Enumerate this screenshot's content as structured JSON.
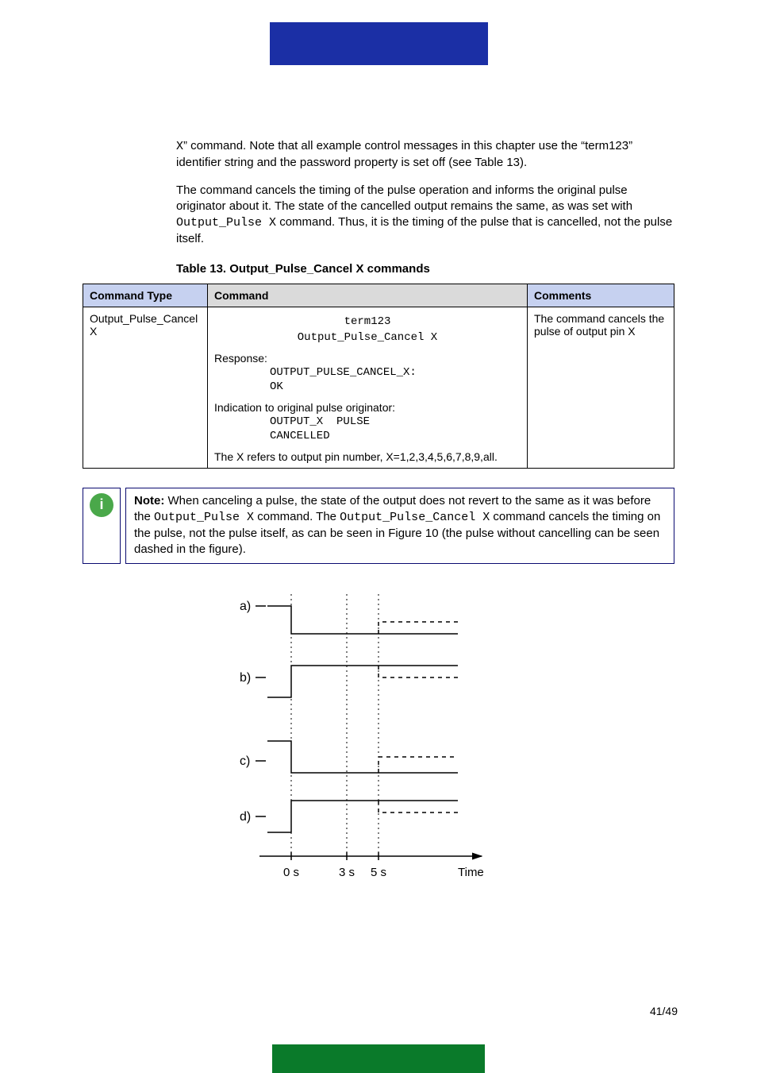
{
  "intro": {
    "para1_prefix_code": "X",
    "para1_text": "” command. Note that all example control messages in this chapter use the “term123” identifier string and the password property is set off (see Table 13).",
    "para2_before_code": "The command cancels the timing of the pulse operation and informs the original pulse originator about it. The state of the cancelled output remains the same, as was set with ",
    "code_in_para2": "Output_Pulse X",
    "para2_after_code": " command. Thus, it is the timing of the pulse that is cancelled, not the pulse itself."
  },
  "table": {
    "caption": "Table 13. Output_Pulse_Cancel X commands",
    "headers": {
      "command_type": "Command Type",
      "command": "Command",
      "comments": "Comments"
    },
    "row": {
      "command_type": "Output_Pulse_Cancel X",
      "command_line1": "term123",
      "command_line2": "Output_Pulse_Cancel X",
      "response_label": "Response:",
      "response_line1": "OUTPUT_PULSE_CANCEL_X:",
      "response_line2": "OK",
      "indication_label": "Indication to original pulse originator:",
      "indication_line1": "OUTPUT_X  PULSE",
      "indication_line2": "CANCELLED",
      "xref": "The X refers to output pin number, X=1,2,3,4,5,6,7,8,9,all.",
      "comments": "The command cancels the pulse of output pin X"
    }
  },
  "note": {
    "icon_glyph": "i",
    "label": "Note:",
    "text_before_code1": " When canceling a pulse, the state of the output does not revert to the same as it was before the ",
    "code1": "Output_Pulse X",
    "text_between_codes": " command. The ",
    "code2": "Output_Pulse_Cancel X",
    "text_after_code2": " command cancels the timing on the pulse, not the pulse itself, as can be seen in Figure 10 (the pulse without cancelling can be seen dashed in the figure)."
  },
  "diagram": {
    "row_labels": [
      "a)",
      "b)",
      "c)",
      "d)"
    ],
    "x_ticks": [
      "0 s",
      "3 s",
      "5 s"
    ],
    "x_axis_label": "Time"
  },
  "page_number": "41/49",
  "chart_data": {
    "type": "line",
    "title": "",
    "xlabel": "Time",
    "ylabel": "",
    "x_ticks_seconds": [
      0,
      3,
      5
    ],
    "events": {
      "pulse_start_s": 0,
      "cancel_at_s": 3,
      "pulse_end_s": 5
    },
    "series": [
      {
        "name": "a",
        "initial_level": 1,
        "pulse_level": 0,
        "cancelled_final_level": 0,
        "uncancelled_final_level": 1
      },
      {
        "name": "b",
        "initial_level": 0,
        "pulse_level": 1,
        "cancelled_final_level": 1,
        "uncancelled_final_level": 0
      },
      {
        "name": "c",
        "initial_level": 1,
        "pulse_level": 0,
        "cancelled_final_level": 0,
        "uncancelled_final_level": 1
      },
      {
        "name": "d",
        "initial_level": 0,
        "pulse_level": 1,
        "cancelled_final_level": 1,
        "uncancelled_final_level": 0
      }
    ],
    "note": "Dashed segment after 5 s shows the output if the pulse were not cancelled; solid line shows actual level after cancel at 3 s."
  }
}
